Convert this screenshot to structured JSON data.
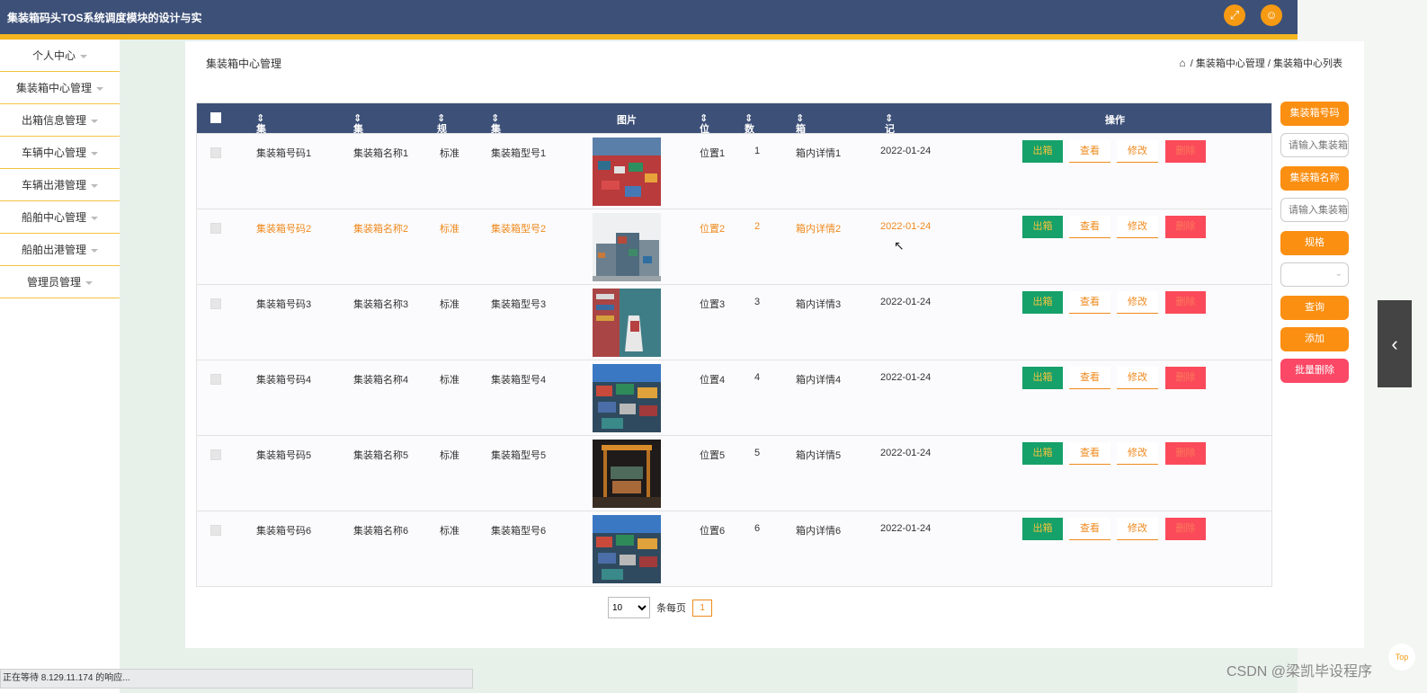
{
  "header": {
    "title": "集装箱码头TOS系统调度模块的设计与实",
    "fullscreen_icon": "expand-icon",
    "user_icon": "user-icon"
  },
  "sidebar": {
    "items": [
      {
        "label": "个人中心"
      },
      {
        "label": "集装箱中心管理"
      },
      {
        "label": "出箱信息管理"
      },
      {
        "label": "车辆中心管理"
      },
      {
        "label": "车辆出港管理"
      },
      {
        "label": "船舶中心管理"
      },
      {
        "label": "船舶出港管理"
      },
      {
        "label": "管理员管理"
      }
    ]
  },
  "main": {
    "title": "集装箱中心管理",
    "breadcrumb": [
      "集装箱中心管理",
      "集装箱中心列表"
    ]
  },
  "table": {
    "headers": {
      "code": "集装箱号码",
      "name": "集装箱名称",
      "spec": "规格",
      "model": "集装箱型号",
      "image": "图片",
      "position": "位置",
      "quantity": "数量",
      "detail": "箱内详情",
      "time": "记录时间",
      "actions": "操作"
    },
    "rows": [
      {
        "code": "集装箱号码1",
        "name": "集装箱名称1",
        "spec": "标准",
        "model": "集装箱型号1",
        "position": "位置1",
        "quantity": "1",
        "detail": "箱内详情1",
        "time": "2022-01-24"
      },
      {
        "code": "集装箱号码2",
        "name": "集装箱名称2",
        "spec": "标准",
        "model": "集装箱型号2",
        "position": "位置2",
        "quantity": "2",
        "detail": "箱内详情2",
        "time": "2022-01-24"
      },
      {
        "code": "集装箱号码3",
        "name": "集装箱名称3",
        "spec": "标准",
        "model": "集装箱型号3",
        "position": "位置3",
        "quantity": "3",
        "detail": "箱内详情3",
        "time": "2022-01-24"
      },
      {
        "code": "集装箱号码4",
        "name": "集装箱名称4",
        "spec": "标准",
        "model": "集装箱型号4",
        "position": "位置4",
        "quantity": "4",
        "detail": "箱内详情4",
        "time": "2022-01-24"
      },
      {
        "code": "集装箱号码5",
        "name": "集装箱名称5",
        "spec": "标准",
        "model": "集装箱型号5",
        "position": "位置5",
        "quantity": "5",
        "detail": "箱内详情5",
        "time": "2022-01-24"
      },
      {
        "code": "集装箱号码6",
        "name": "集装箱名称6",
        "spec": "标准",
        "model": "集装箱型号6",
        "position": "位置6",
        "quantity": "6",
        "detail": "箱内详情6",
        "time": "2022-01-24"
      }
    ],
    "actions": {
      "out": "出箱",
      "view": "查看",
      "edit": "修改",
      "delete": "删除"
    }
  },
  "pagination": {
    "page_size": "10",
    "per_page_label": "条每页",
    "current_page": "1"
  },
  "search": {
    "code_label": "集装箱号码",
    "code_placeholder": "请输入集装箱",
    "name_label": "集装箱名称",
    "name_placeholder": "请输入集装箱",
    "spec_label": "规格",
    "query": "查询",
    "add": "添加",
    "batch_delete": "批量删除"
  },
  "misc": {
    "top_label": "Top",
    "status": "正在等待 8.129.11.174 的响应...",
    "watermark": "CSDN @梁凯毕设程序"
  },
  "colors": {
    "header": "#3d5078",
    "accent": "#fb8f12",
    "out_button": "#16a06a",
    "delete_button": "#fb4a5a",
    "highlight_row_text": "#ef8a1e"
  }
}
